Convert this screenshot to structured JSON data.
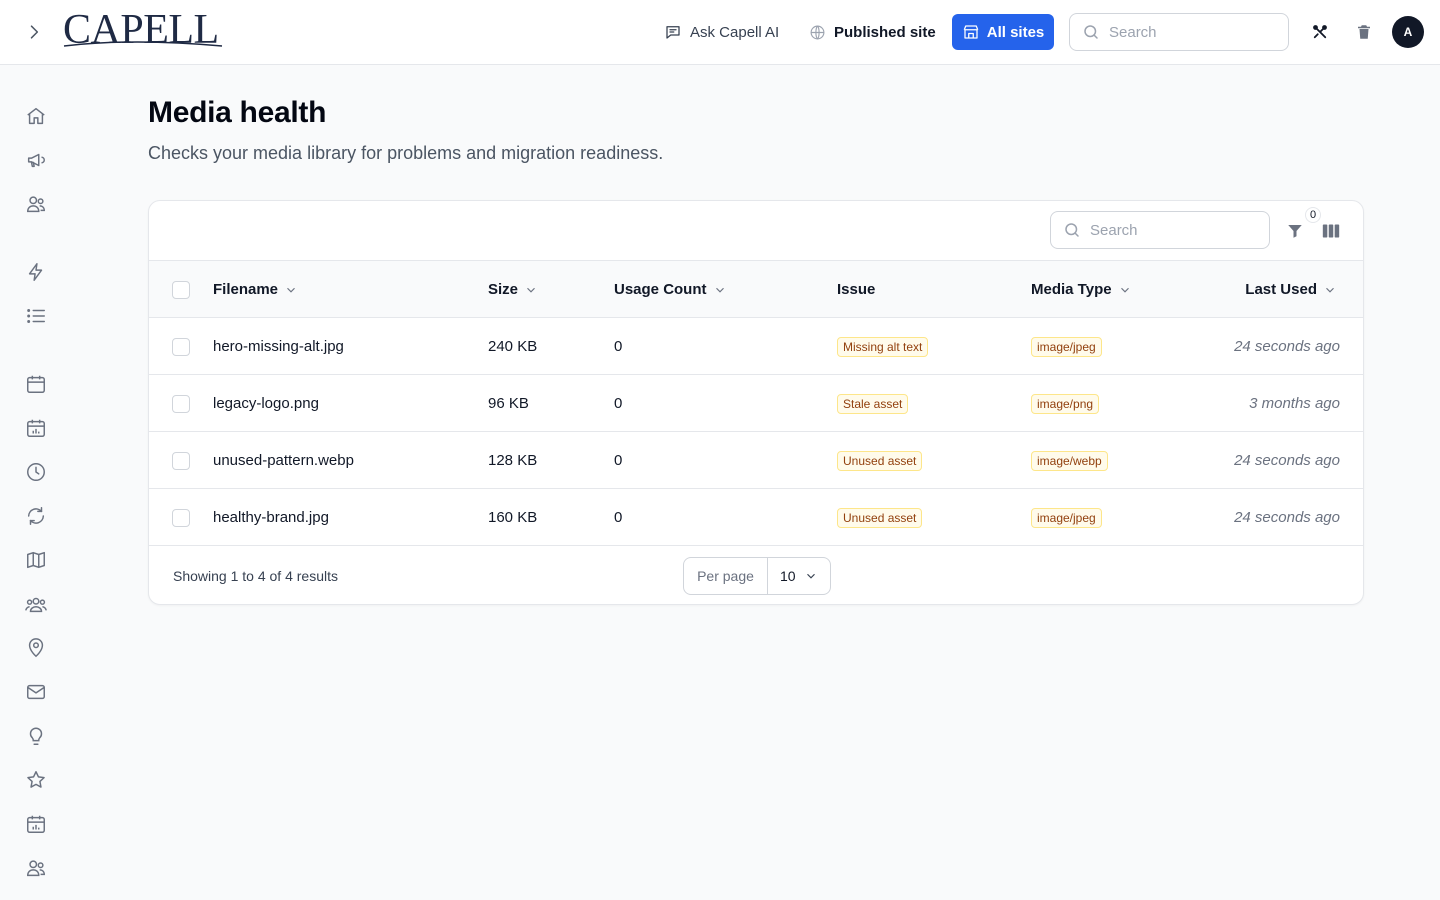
{
  "header": {
    "logo_text": "CAPELL",
    "ask_ai_label": "Ask Capell AI",
    "published_label": "Published site",
    "all_sites_label": "All sites",
    "search_placeholder": "Search",
    "avatar_initial": "A"
  },
  "sidebar": {
    "icons": [
      "home-icon",
      "megaphone-icon",
      "users-icon",
      "bolt-icon",
      "list-icon",
      "calendar-icon",
      "calendar-chart-icon",
      "clock-icon",
      "refresh-icon",
      "map-icon",
      "user-group-icon",
      "map-pin-icon",
      "mail-icon",
      "lightbulb-icon",
      "star-icon",
      "calendar-chart-icon",
      "users-icon"
    ]
  },
  "page": {
    "title": "Media health",
    "subtitle": "Checks your media library for problems and migration readiness."
  },
  "table": {
    "search_placeholder": "Search",
    "filter_count": "0",
    "columns": {
      "filename": "Filename",
      "size": "Size",
      "usage": "Usage Count",
      "issue": "Issue",
      "media_type": "Media Type",
      "last_used": "Last Used"
    },
    "rows": [
      {
        "filename": "hero-missing-alt.jpg",
        "size": "240 KB",
        "usage": "0",
        "issue": "Missing alt text",
        "media_type": "image/jpeg",
        "last_used": "24 seconds ago"
      },
      {
        "filename": "legacy-logo.png",
        "size": "96 KB",
        "usage": "0",
        "issue": "Stale asset",
        "media_type": "image/png",
        "last_used": "3 months ago"
      },
      {
        "filename": "unused-pattern.webp",
        "size": "128 KB",
        "usage": "0",
        "issue": "Unused asset",
        "media_type": "image/webp",
        "last_used": "24 seconds ago"
      },
      {
        "filename": "healthy-brand.jpg",
        "size": "160 KB",
        "usage": "0",
        "issue": "Unused asset",
        "media_type": "image/jpeg",
        "last_used": "24 seconds ago"
      }
    ],
    "footer": {
      "showing": "Showing 1 to 4 of 4 results",
      "per_page_label": "Per page",
      "per_page_value": "10"
    }
  },
  "colors": {
    "primary": "#2563eb",
    "badge_bg": "#fffbeb",
    "badge_text": "#92400e"
  }
}
